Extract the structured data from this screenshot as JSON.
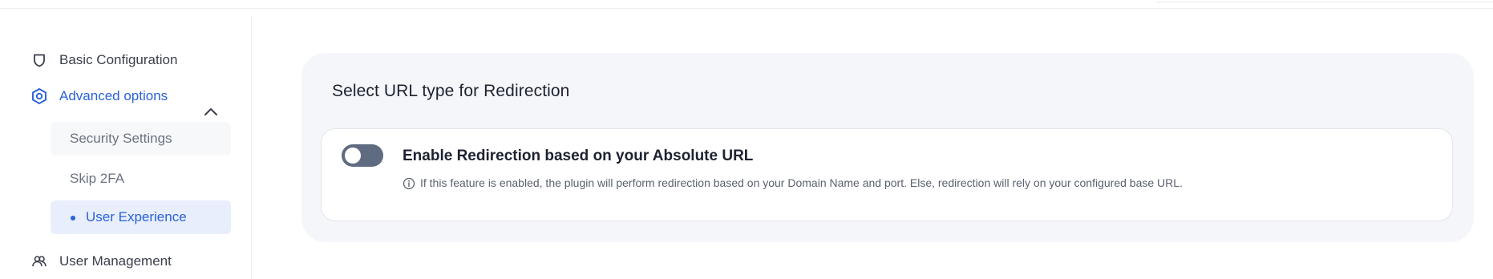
{
  "sidebar": {
    "items": [
      {
        "label": "Basic Configuration",
        "icon": "shield-icon"
      },
      {
        "label": "Advanced options",
        "icon": "hexagon-gear-icon",
        "expanded": true
      },
      {
        "label": "User Management",
        "icon": "users-icon"
      }
    ],
    "subitems": [
      {
        "label": "Security Settings"
      },
      {
        "label": "Skip 2FA"
      },
      {
        "label": "User Experience",
        "active": true
      }
    ]
  },
  "main": {
    "section_title": "Select URL type for Redirection",
    "setting": {
      "title": "Enable Redirection based on your Absolute URL",
      "enabled": false,
      "description": "If this feature is enabled, the plugin will perform redirection based on your Domain Name and port. Else, redirection will rely on your configured base URL."
    }
  },
  "colors": {
    "accent": "#2962d9",
    "toggle_off": "#5f6b80",
    "panel_bg": "#f5f6f9"
  }
}
